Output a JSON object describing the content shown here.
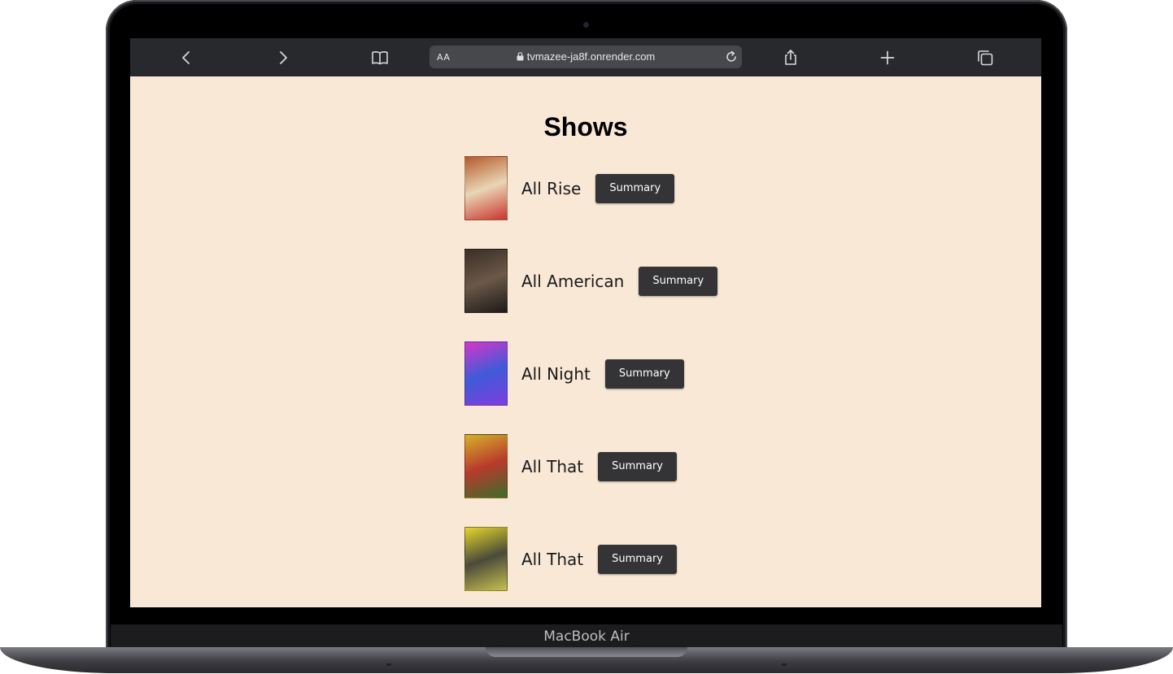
{
  "device": {
    "label": "MacBook Air"
  },
  "browser": {
    "address_left": "AA",
    "url": "tvmazee-ja8f.onrender.com"
  },
  "page": {
    "title": "Shows",
    "shows": [
      {
        "name": "All Rise",
        "button": "Summary",
        "poster_colors": [
          "#b35a2a",
          "#e9d6b5",
          "#c9342e"
        ]
      },
      {
        "name": "All American",
        "button": "Summary",
        "poster_colors": [
          "#3a2e26",
          "#6b5848",
          "#1d1a18"
        ]
      },
      {
        "name": "All Night",
        "button": "Summary",
        "poster_colors": [
          "#d635c9",
          "#3f5bd8",
          "#7e3de0"
        ]
      },
      {
        "name": "All That",
        "button": "Summary",
        "poster_colors": [
          "#d7b12a",
          "#b83a2c",
          "#3a6e2a"
        ]
      },
      {
        "name": "All That",
        "button": "Summary",
        "poster_colors": [
          "#e6d62a",
          "#4a4a3a",
          "#c8c050"
        ]
      }
    ]
  },
  "colors": {
    "page_background": "#f9e8d6",
    "button_background": "#343436",
    "toolbar_background": "#27292c"
  }
}
